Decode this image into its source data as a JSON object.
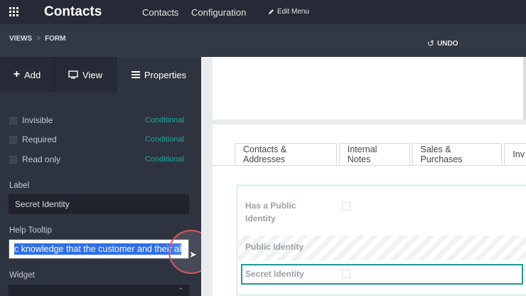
{
  "topbar": {
    "app_title": "Contacts",
    "menu": [
      "Contacts",
      "Configuration"
    ],
    "edit_menu": "Edit Menu",
    "icons": {
      "apps": "apps-grid-icon",
      "edit": "pencil-icon"
    }
  },
  "subbar": {
    "breadcrumb": [
      "VIEWS",
      "FORM"
    ],
    "undo_label": "UNDO"
  },
  "sidebar": {
    "tabs": [
      {
        "label": "Add",
        "icon": "plus-icon"
      },
      {
        "label": "View",
        "icon": "monitor-icon"
      },
      {
        "label": "Properties",
        "icon": "list-icon"
      }
    ],
    "options": [
      {
        "label": "Invisible",
        "link": "Conditional"
      },
      {
        "label": "Required",
        "link": "Conditional"
      },
      {
        "label": "Read only",
        "link": "Conditional"
      }
    ],
    "label_title": "Label",
    "label_value": "Secret Identity",
    "tooltip_title": "Help Tooltip",
    "tooltip_value": "c knowledge that the customer and their al",
    "widget_title": "Widget",
    "widget_value": ""
  },
  "form": {
    "tabs": [
      "Contacts & Addresses",
      "Internal Notes",
      "Sales & Purchases",
      "Inv"
    ],
    "fields": {
      "has_public": "Has a Public Identity",
      "public_identity": "Public Identity",
      "secret_identity": "Secret Identity"
    }
  },
  "colors": {
    "topbar": "#262a36",
    "sidebar": "#2e3340",
    "accent": "#1ba79b",
    "selection": "#2f6ee8",
    "highlight_ring": "#d8575d"
  }
}
